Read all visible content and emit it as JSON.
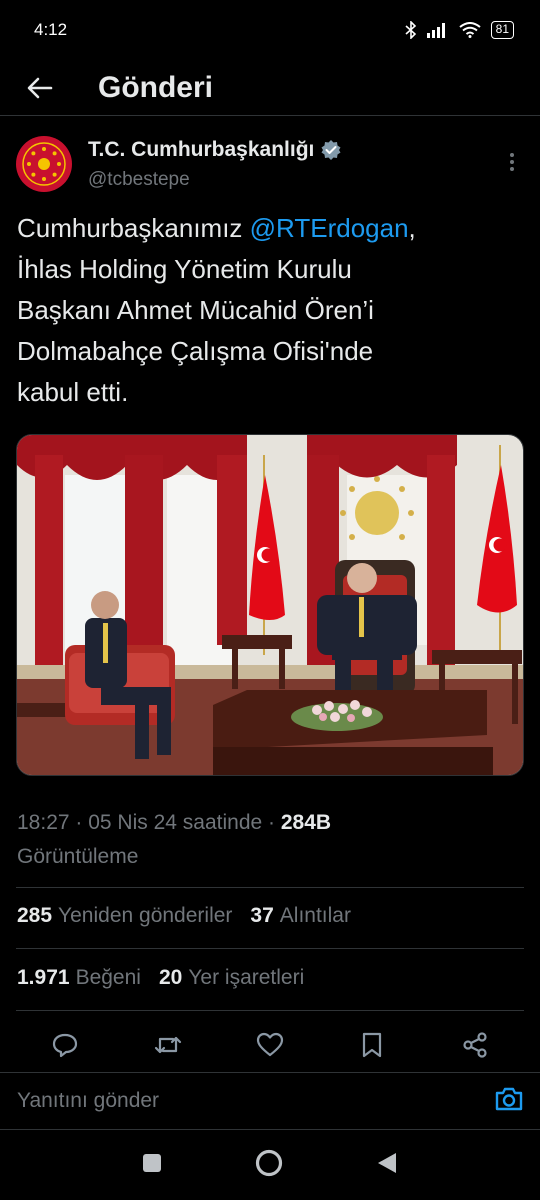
{
  "status_bar": {
    "time": "4:12",
    "battery": "81"
  },
  "header": {
    "title": "Gönderi"
  },
  "author": {
    "name": "T.C. Cumhurbaşkanlığı",
    "handle": "@tcbestepe"
  },
  "tweet": {
    "text_before": "Cumhurbaşkanımız ",
    "mention": "@RTErdogan",
    "text_after": ",\nİhlas Holding Yönetim Kurulu\nBaşkanı Ahmet Mücahid Ören’i\nDolmabahçe Çalışma Ofisi'nde\nkabul etti."
  },
  "meta": {
    "time": "18:27",
    "date": "05 Nis 24 saatinde",
    "views_count": "284B",
    "views_label": "Görüntüleme"
  },
  "stats": {
    "reposts_count": "285",
    "reposts_label": "Yeniden gönderiler",
    "quotes_count": "37",
    "quotes_label": "Alıntılar",
    "likes_count": "1.971",
    "likes_label": "Beğeni",
    "bookmarks_count": "20",
    "bookmarks_label": "Yer işaretleri"
  },
  "reply": {
    "placeholder": "Yanıtını gönder"
  },
  "icons": {
    "back": "arrow-left-icon",
    "verified": "verified-badge-icon",
    "more": "more-vertical-icon",
    "reply": "reply-icon",
    "repost": "repost-icon",
    "like": "heart-icon",
    "bookmark": "bookmark-icon",
    "share": "share-icon",
    "camera": "camera-icon"
  },
  "colors": {
    "accent": "#1d9bf0",
    "background": "#000000",
    "muted": "#71767b",
    "text": "#e7e9ea"
  }
}
